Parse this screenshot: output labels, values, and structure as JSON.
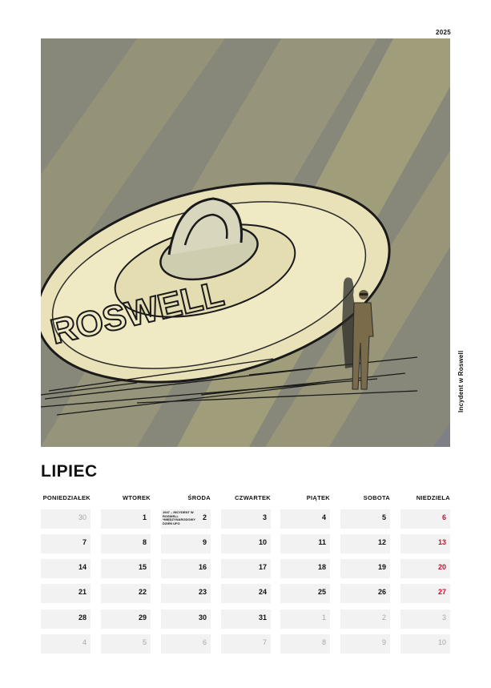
{
  "year": "2025",
  "illustration": {
    "ufo_text": "ROSWELL",
    "caption": "Incydent w Roswell"
  },
  "month": "LIPIEC",
  "weekdays": [
    "PONIEDZIAŁEK",
    "WTOREK",
    "ŚRODA",
    "CZWARTEK",
    "PIĄTEK",
    "SOBOTA",
    "NIEDZIELA"
  ],
  "weeks": [
    [
      {
        "d": "30",
        "out": true
      },
      {
        "d": "1"
      },
      {
        "d": "2",
        "note": "1947 – INCYDENT W ROSWELL *MIĘDZYNARODOWY DZIEŃ UFO"
      },
      {
        "d": "3"
      },
      {
        "d": "4"
      },
      {
        "d": "5"
      },
      {
        "d": "6",
        "sun": true
      }
    ],
    [
      {
        "d": "7"
      },
      {
        "d": "8"
      },
      {
        "d": "9"
      },
      {
        "d": "10"
      },
      {
        "d": "11"
      },
      {
        "d": "12"
      },
      {
        "d": "13",
        "sun": true
      }
    ],
    [
      {
        "d": "14"
      },
      {
        "d": "15"
      },
      {
        "d": "16"
      },
      {
        "d": "17"
      },
      {
        "d": "18"
      },
      {
        "d": "19"
      },
      {
        "d": "20",
        "sun": true
      }
    ],
    [
      {
        "d": "21"
      },
      {
        "d": "22"
      },
      {
        "d": "23"
      },
      {
        "d": "24"
      },
      {
        "d": "25"
      },
      {
        "d": "26"
      },
      {
        "d": "27",
        "sun": true
      }
    ],
    [
      {
        "d": "28"
      },
      {
        "d": "29"
      },
      {
        "d": "30"
      },
      {
        "d": "31"
      },
      {
        "d": "1",
        "out": true
      },
      {
        "d": "2",
        "out": true
      },
      {
        "d": "3",
        "out": true
      }
    ],
    [
      {
        "d": "4",
        "out": true
      },
      {
        "d": "5",
        "out": true
      },
      {
        "d": "6",
        "out": true
      },
      {
        "d": "7",
        "out": true
      },
      {
        "d": "8",
        "out": true
      },
      {
        "d": "9",
        "out": true
      },
      {
        "d": "10",
        "out": true
      }
    ]
  ],
  "colors": {
    "sunday": "#c8102e",
    "out_of_month": "#a6a6a6",
    "cell_bg": "#f2f2f2",
    "sky": "#87877a",
    "light_ray": "#b4ae7a",
    "ufo": "#efe9c4"
  }
}
